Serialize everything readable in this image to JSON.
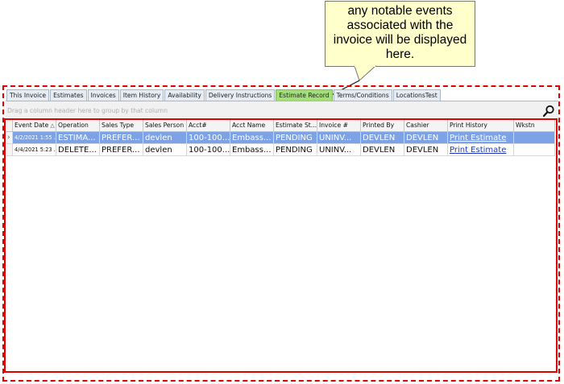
{
  "callout": {
    "lines": [
      "any notable events",
      "associated with the",
      "invoice will be displayed",
      "here."
    ]
  },
  "tabs": [
    {
      "label": "This Invoice",
      "active": false
    },
    {
      "label": "Estimates",
      "active": false
    },
    {
      "label": "Invoices",
      "active": false
    },
    {
      "label": "Item History",
      "active": false
    },
    {
      "label": "Availability",
      "active": false
    },
    {
      "label": "Delivery Instructions",
      "active": false
    },
    {
      "label": "Estimate Record",
      "active": true
    },
    {
      "label": "Terms/Conditions",
      "active": false
    },
    {
      "label": "LocationsTest",
      "active": false
    }
  ],
  "grid": {
    "group_hint": "Drag a column header here to group by that column",
    "columns": [
      "Event Date",
      "Operation",
      "Sales Type",
      "Sales Person",
      "Acct#",
      "Acct Name",
      "Estimate St...",
      "Invoice #",
      "Printed By",
      "Cashier",
      "Print History",
      "Wkstn"
    ],
    "rows": [
      {
        "indicator": "›",
        "cells": [
          "4/2/2021 1:55 ...",
          "ESTIMA...",
          "PREFER...",
          "devlen",
          "100-100...",
          "Embass...",
          "PENDING",
          "UNINV...",
          "DEVLEN",
          "DEVLEN",
          "Print Estimate",
          ""
        ]
      },
      {
        "indicator": "",
        "cells": [
          "4/4/2021 5:23 ...",
          "DELETE...",
          "PREFER...",
          "devlen",
          "100-100...",
          "Embass...",
          "PENDING",
          "UNINV...",
          "DEVLEN",
          "DEVLEN",
          "Print Estimate",
          ""
        ]
      }
    ]
  },
  "colors": {
    "annotation_red": "#e00000",
    "selected_row": "#7ea2e6",
    "active_tab": "#a3de79",
    "callout_fill": "#ffffcc"
  },
  "icons": {
    "find": "magnifier-icon",
    "sort": "sort-ascending-icon",
    "row_indicator": "current-row-indicator-icon"
  }
}
